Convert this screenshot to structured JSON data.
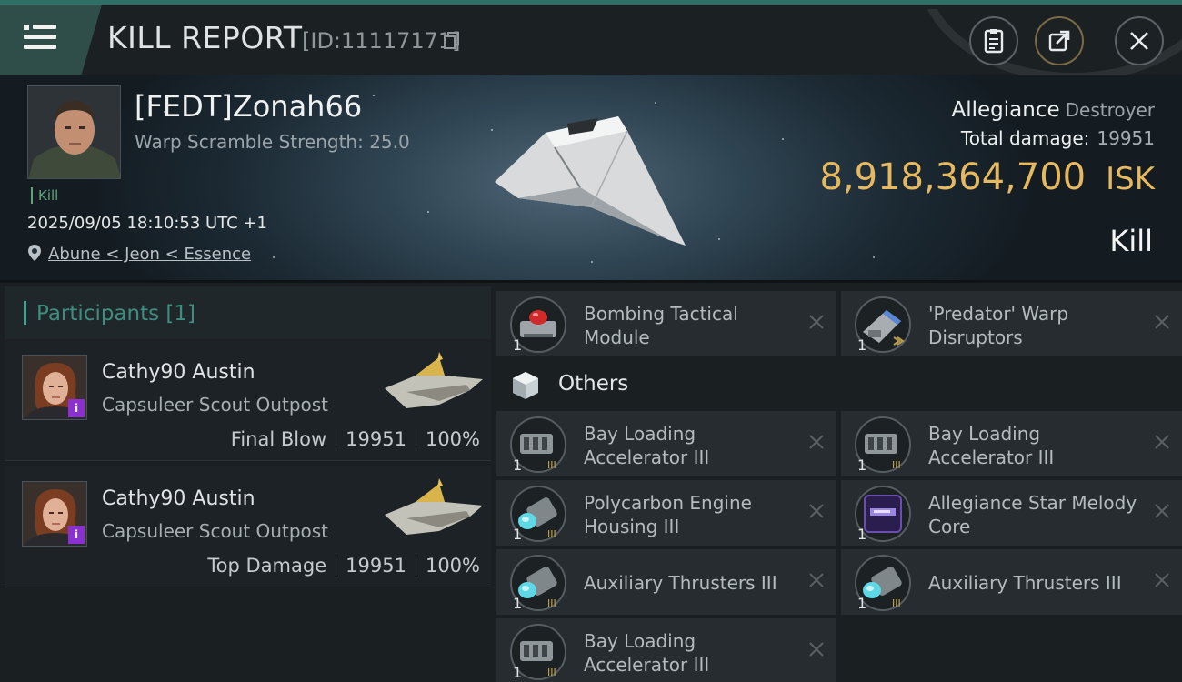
{
  "header": {
    "title": "KILL REPORT",
    "report_id": "[ID:11117171]",
    "menu_icon": "hamburger-menu-icon",
    "actions": [
      {
        "icon": "clipboard-icon"
      },
      {
        "icon": "share-export-icon"
      },
      {
        "icon": "close-icon"
      }
    ]
  },
  "victim": {
    "pilot_name": "[FEDT]Zonah66",
    "warp_scramble_label": "Warp Scramble Strength: 25.0",
    "kill_tag": "Kill",
    "datetime": "2025/09/05 18:10:53 UTC +1",
    "location": "Abune < Jeon < Essence",
    "ship_name": "Allegiance",
    "ship_class": "Destroyer",
    "total_damage_label": "Total damage:",
    "total_damage_value": "19951",
    "isk_value": "8,918,364,700",
    "isk_unit": "ISK",
    "result": "Kill"
  },
  "participants": {
    "header": "Participants [1]",
    "list": [
      {
        "name": "Cathy90 Austin",
        "corp": "Capsuleer Scout Outpost",
        "role": "Final Blow",
        "damage": "19951",
        "percent": "100%",
        "badge": "i"
      },
      {
        "name": "Cathy90 Austin",
        "corp": "Capsuleer Scout Outpost",
        "role": "Top Damage",
        "damage": "19951",
        "percent": "100%",
        "badge": "i"
      }
    ]
  },
  "modules": {
    "top": [
      {
        "qty": "1",
        "name": "Bombing Tactical Module",
        "icon": "bombing-module-icon",
        "tier": ""
      },
      {
        "qty": "1",
        "name": "'Predator' Warp Disruptors",
        "icon": "warp-disruptor-icon",
        "tier": "≫"
      }
    ],
    "others_label": "Others",
    "others_icon": "cube-icon",
    "others": [
      {
        "qty": "1",
        "name": "Bay Loading Accelerator III",
        "icon": "bay-loading-icon",
        "tier": "III"
      },
      {
        "qty": "1",
        "name": "Bay Loading Accelerator III",
        "icon": "bay-loading-icon",
        "tier": "III"
      },
      {
        "qty": "1",
        "name": "Polycarbon Engine Housing III",
        "icon": "engine-housing-icon",
        "tier": "III"
      },
      {
        "qty": "1",
        "name": "Allegiance Star Melody Core",
        "icon": "star-melody-core-icon",
        "tier": ""
      },
      {
        "qty": "1",
        "name": "Auxiliary Thrusters III",
        "icon": "thruster-icon",
        "tier": "III"
      },
      {
        "qty": "1",
        "name": "Auxiliary Thrusters III",
        "icon": "thruster-icon",
        "tier": "III"
      },
      {
        "qty": "1",
        "name": "Bay Loading Accelerator III",
        "icon": "bay-loading-icon",
        "tier": "III"
      }
    ]
  },
  "colors": {
    "accent_teal": "#46a08f",
    "isk_gold": "#e6b860",
    "kill_green": "#5ea37c",
    "badge_purple": "#8a2fd0"
  }
}
